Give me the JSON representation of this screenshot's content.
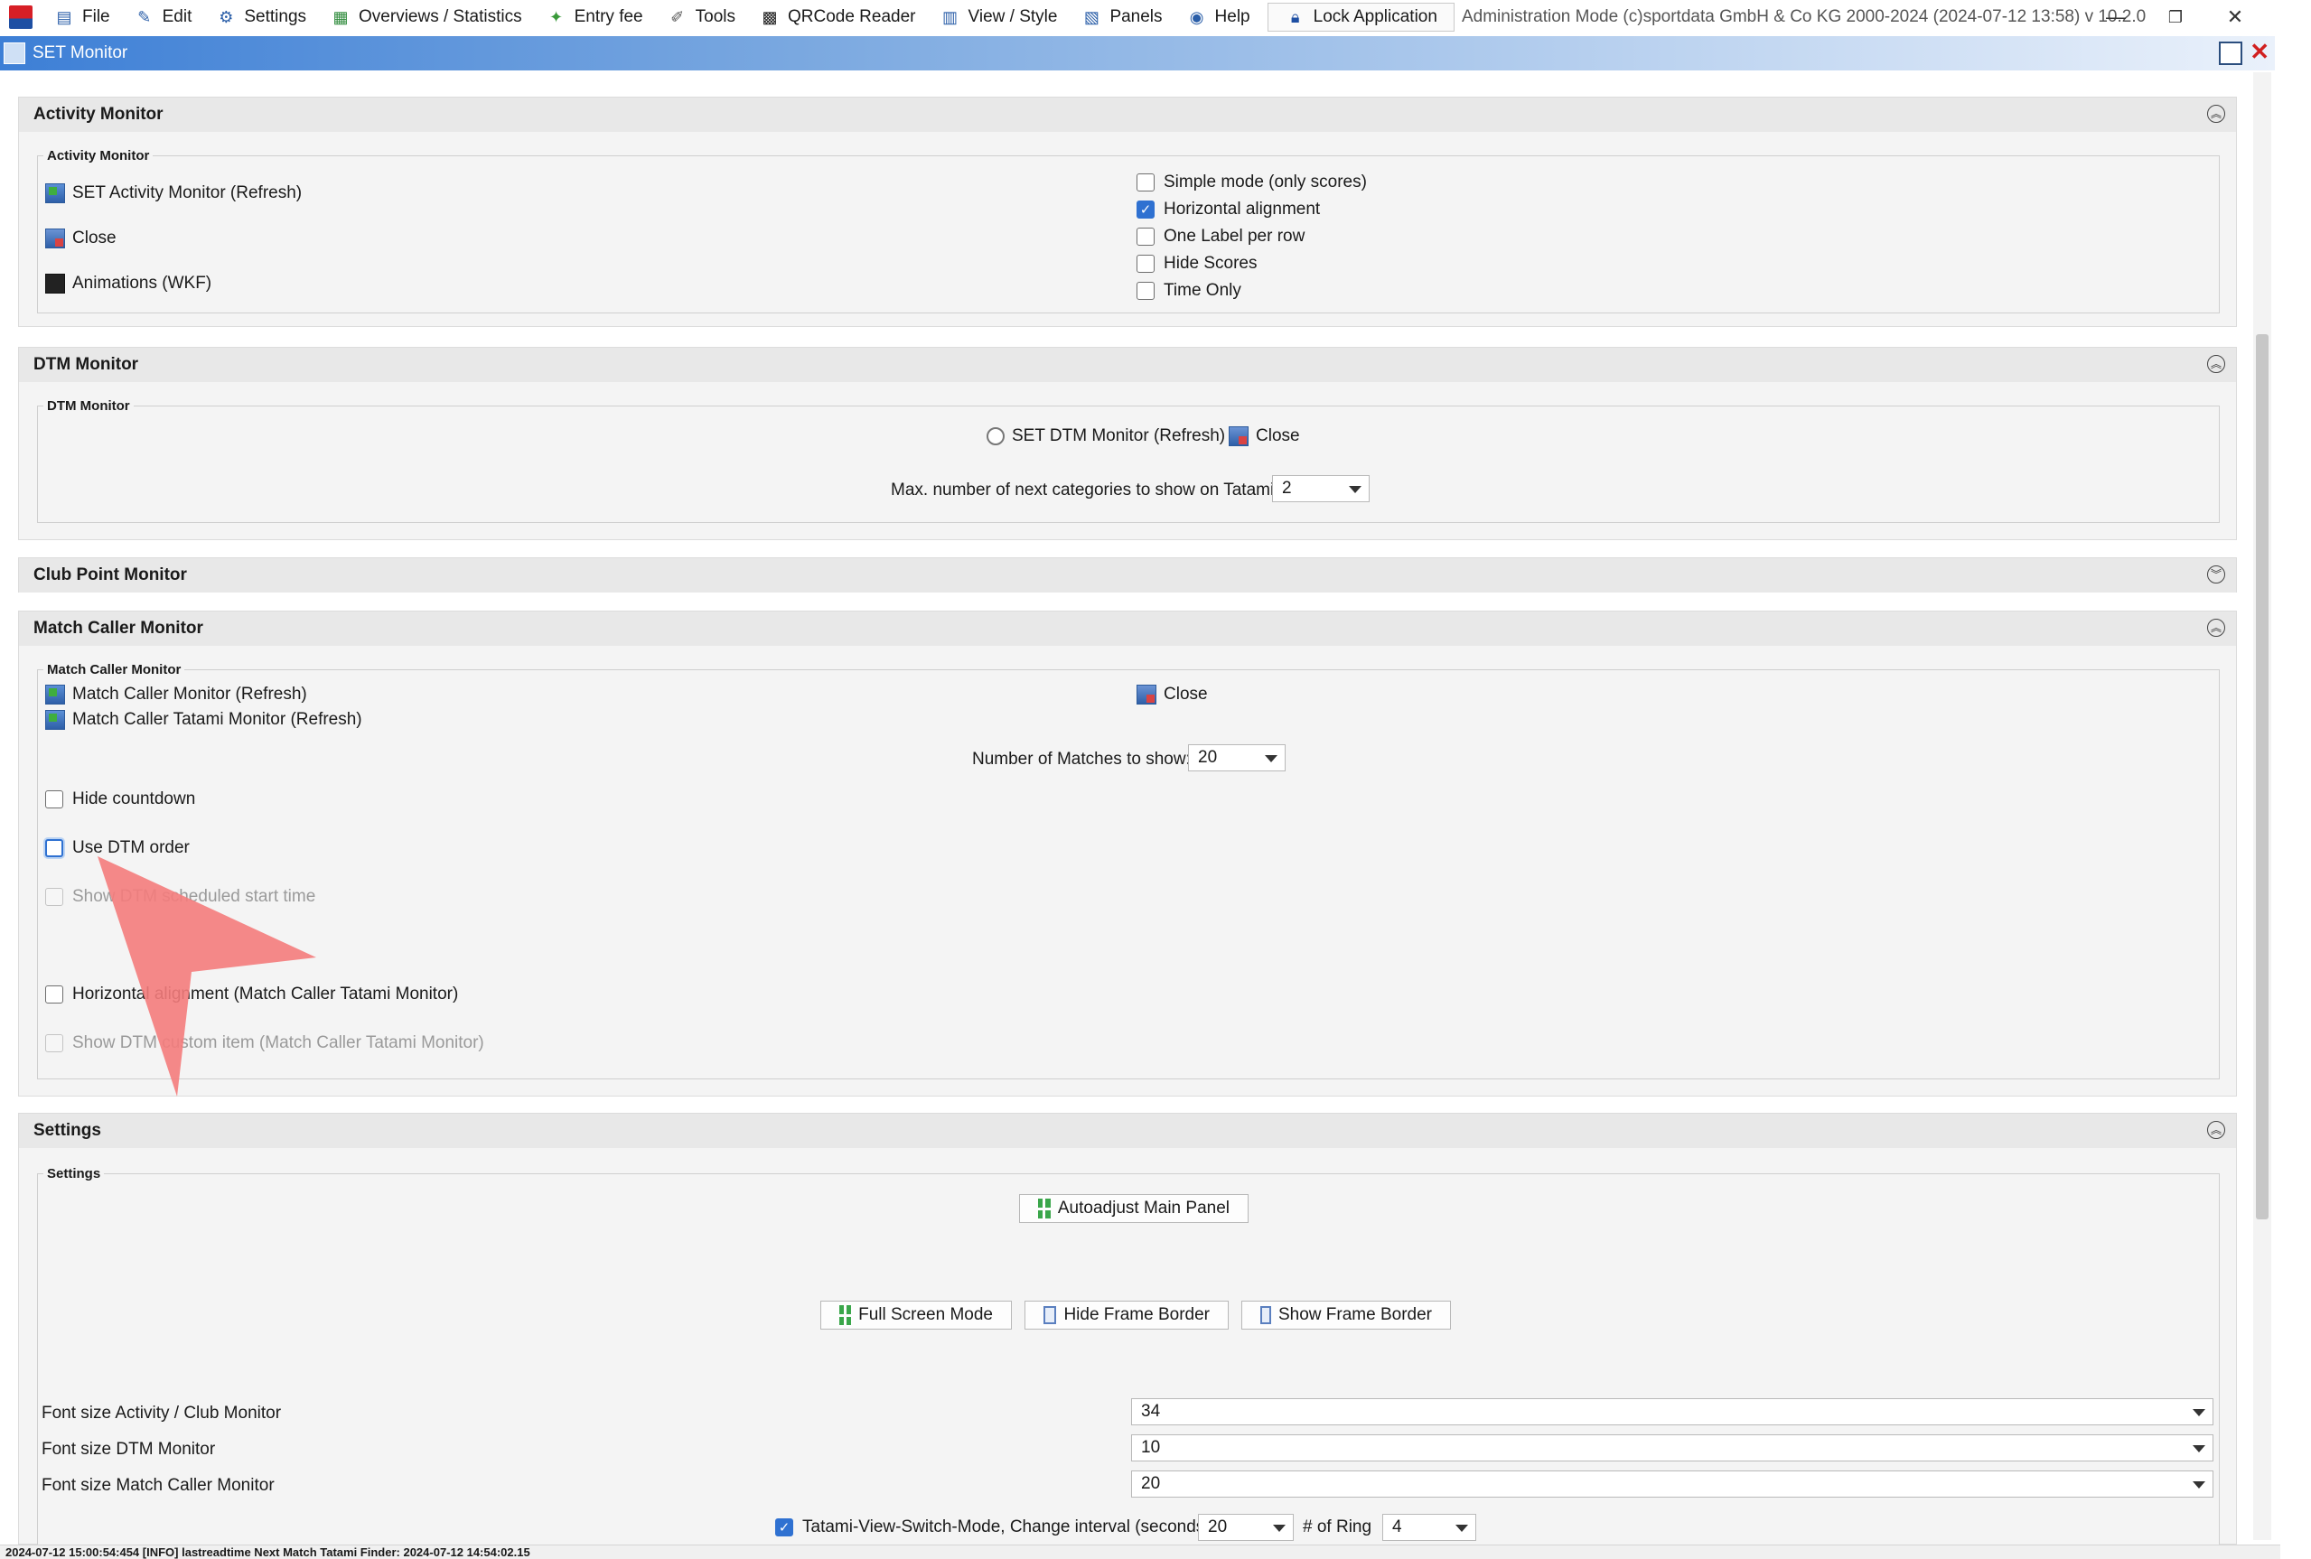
{
  "menubar": {
    "items": [
      {
        "label": "File",
        "icon": "file-icon"
      },
      {
        "label": "Edit",
        "icon": "edit-icon"
      },
      {
        "label": "Settings",
        "icon": "gear-icon"
      },
      {
        "label": "Overviews / Statistics",
        "icon": "statistics-icon"
      },
      {
        "label": "Entry fee",
        "icon": "money-icon"
      },
      {
        "label": "Tools",
        "icon": "wrench-icon"
      },
      {
        "label": "QRCode Reader",
        "icon": "qrcode-icon"
      },
      {
        "label": "View / Style",
        "icon": "view-icon"
      },
      {
        "label": "Panels",
        "icon": "panels-icon"
      },
      {
        "label": "Help",
        "icon": "help-icon"
      }
    ],
    "lock_label": "Lock Application",
    "admin_text": "Administration Mode (c)sportdata GmbH & Co KG 2000-2024 (2024-07-12 13:58)  v 10.2.0 ..."
  },
  "frame": {
    "title": "SET Monitor"
  },
  "activity": {
    "title": "Activity Monitor",
    "group_label": "Activity Monitor",
    "links": [
      "SET Activity Monitor (Refresh)",
      "Close",
      "Animations (WKF)"
    ],
    "options": [
      {
        "label": "Simple mode (only scores)",
        "checked": false
      },
      {
        "label": "Horizontal alignment",
        "checked": true
      },
      {
        "label": "One Label per row",
        "checked": false
      },
      {
        "label": "Hide Scores",
        "checked": false
      },
      {
        "label": "Time Only",
        "checked": false
      }
    ]
  },
  "dtm": {
    "title": "DTM Monitor",
    "group_label": "DTM Monitor",
    "refresh": "SET DTM Monitor (Refresh)",
    "close": "Close",
    "max_label": "Max. number of next categories to show on Tatamis:",
    "max_value": "2"
  },
  "club": {
    "title": "Club Point Monitor"
  },
  "caller": {
    "title": "Match Caller Monitor",
    "group_label": "Match Caller Monitor",
    "refresh": "Match Caller Monitor (Refresh)",
    "tatami_refresh": "Match Caller Tatami Monitor (Refresh)",
    "close": "Close",
    "matches_label": "Number of Matches to show:",
    "matches_value": "20",
    "hide_countdown": "Hide countdown",
    "use_dtm_order": "Use DTM order",
    "show_dtm_start": "Show DTM scheduled start time",
    "horizontal": "Horizontal alignment (Match Caller Tatami Monitor)",
    "show_custom": "Show DTM custom item (Match Caller Tatami Monitor)"
  },
  "settings": {
    "title": "Settings",
    "group_label": "Settings",
    "autoadjust": "Autoadjust Main Panel",
    "fullscreen": "Full Screen Mode",
    "hide_border": "Hide Frame Border",
    "show_border": "Show Frame Border",
    "fonts": [
      {
        "label": "Font size Activity / Club Monitor",
        "value": "34"
      },
      {
        "label": "Font size DTM Monitor",
        "value": "10"
      },
      {
        "label": "Font size Match Caller Monitor",
        "value": "20"
      }
    ],
    "tatami_switch_label": "Tatami-View-Switch-Mode, Change interval (seconds)",
    "tatami_switch_value": "20",
    "ring_label": "# of Ring",
    "ring_value": "4"
  },
  "status": {
    "text": "2024-07-12 15:00:54:454 [INFO] lastreadtime Next Match Tatami Finder: 2024-07-12 14:54:02.15"
  },
  "colors": {
    "accent": "#2f71d1",
    "pointer": "#f47c7c",
    "close_red": "#d12020"
  }
}
